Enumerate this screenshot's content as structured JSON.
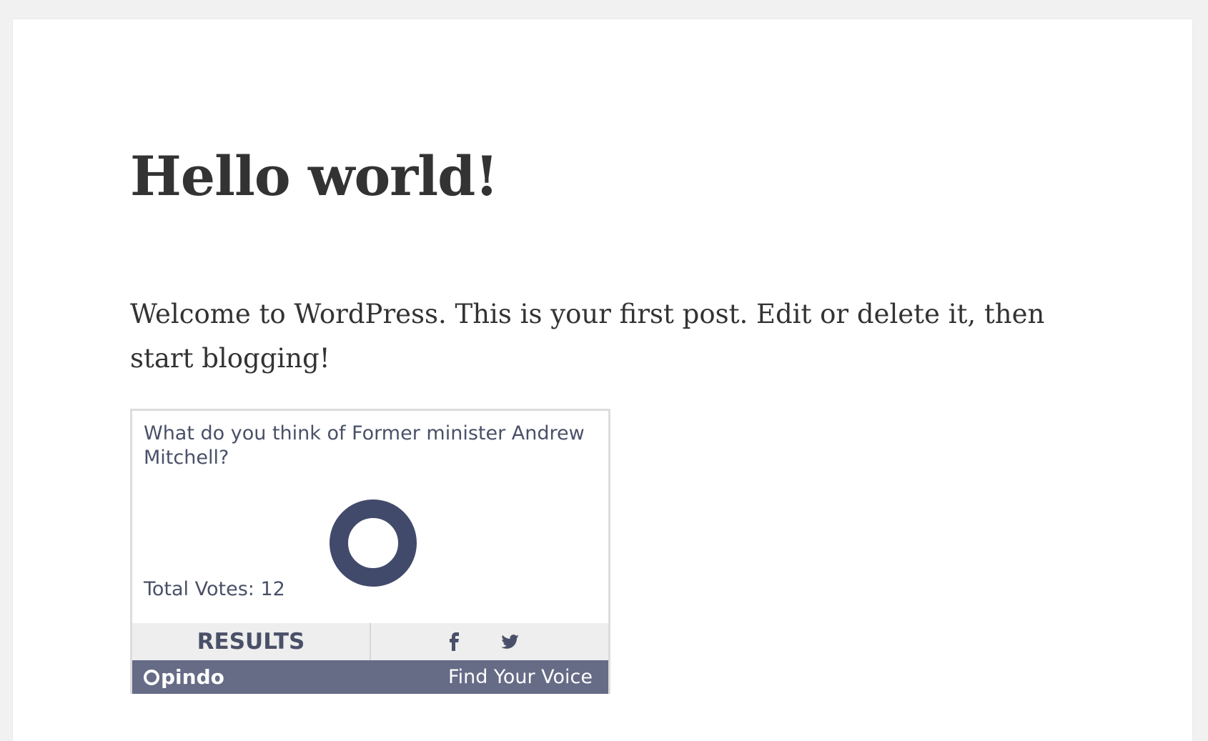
{
  "post": {
    "title": "Hello world!",
    "content": "Welcome to WordPress. This is your first post. Edit or delete it, then start blogging!"
  },
  "poll": {
    "question": "What do you think of Former minister Andrew Mitchell?",
    "total_votes_label": "Total Votes:",
    "total_votes": "12",
    "results_label": "RESULTS",
    "share_icons": [
      "facebook-icon",
      "twitter-icon"
    ],
    "brand": "Opindo",
    "brand_logo_letter": "O",
    "tagline": "Find Your Voice",
    "ring_color": "#414a6a",
    "footer_color": "#666b86",
    "actions_bg": "#eeeeee"
  }
}
